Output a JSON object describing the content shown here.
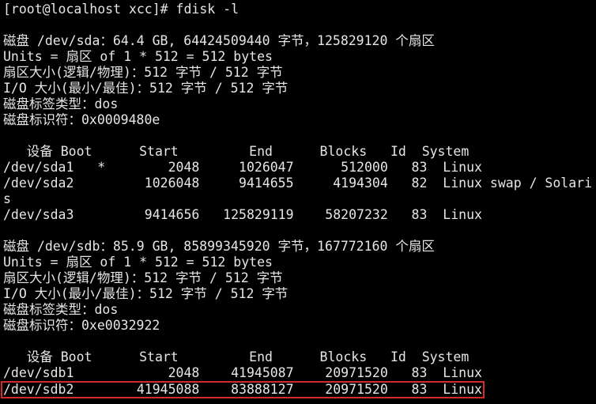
{
  "terminal": {
    "lines": [
      "[root@localhost xcc]# fdisk -l",
      "",
      "磁盘 /dev/sda：64.4 GB, 64424509440 字节，125829120 个扇区",
      "Units = 扇区 of 1 * 512 = 512 bytes",
      "扇区大小(逻辑/物理)：512 字节 / 512 字节",
      "I/O 大小(最小/最佳)：512 字节 / 512 字节",
      "磁盘标签类型：dos",
      "磁盘标识符：0x0009480e",
      "",
      "   设备 Boot      Start         End      Blocks   Id  System",
      "/dev/sda1   *        2048     1026047      512000   83  Linux",
      "/dev/sda2         1026048     9414655     4194304   82  Linux swap / Solari",
      "s",
      "/dev/sda3         9414656   125829119    58207232   83  Linux",
      "",
      "磁盘 /dev/sdb：85.9 GB, 85899345920 字节，167772160 个扇区",
      "Units = 扇区 of 1 * 512 = 512 bytes",
      "扇区大小(逻辑/物理)：512 字节 / 512 字节",
      "I/O 大小(最小/最佳)：512 字节 / 512 字节",
      "磁盘标签类型：dos",
      "磁盘标识符：0xe0032922",
      "",
      "   设备 Boot      Start         End      Blocks   Id  System",
      "/dev/sdb1            2048    41945087    20971520   83  Linux",
      "/dev/sdb2        41945088    83888127    20971520   83  Linux"
    ],
    "highlight_color": "#d32b2b",
    "background_color": "#000000",
    "text_color": "#e6e6e6"
  }
}
